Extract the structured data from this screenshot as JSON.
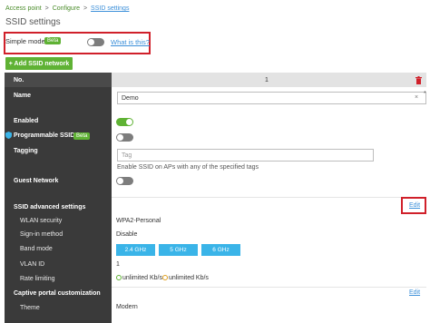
{
  "breadcrumb": {
    "item1": "Access point",
    "item2": "Configure",
    "current": "SSID settings",
    "sep": ">"
  },
  "title": "SSID settings",
  "simple_mode": {
    "label": "Simple mode",
    "badge": "Beta",
    "link": "What is this?"
  },
  "add_button": "+ Add SSID network",
  "header": {
    "no_label": "No.",
    "number": "1"
  },
  "rows": {
    "name": {
      "label": "Name",
      "value": "Demo",
      "clear": "×",
      "required": "*"
    },
    "enabled": {
      "label": "Enabled"
    },
    "programmable": {
      "label": "Programmable SSID",
      "badge": "Beta"
    },
    "tagging": {
      "label": "Tagging",
      "placeholder": "Tag",
      "help": "Enable SSID on APs with any of the specified tags"
    },
    "guest": {
      "label": "Guest Network"
    },
    "advanced": {
      "label": "SSID advanced settings",
      "edit": "Edit"
    },
    "wlan_security": {
      "label": "WLAN security",
      "value": "WPA2-Personal"
    },
    "sign_in": {
      "label": "Sign-in method",
      "value": "Disable"
    },
    "band_mode": {
      "label": "Band mode",
      "bands": [
        "2.4 GHz",
        "5 GHz",
        "6 GHz"
      ]
    },
    "vlan": {
      "label": "VLAN ID",
      "value": "1"
    },
    "rate": {
      "label": "Rate limiting",
      "down": "unlimited Kb/s",
      "up": "unlimited Kb/s"
    },
    "captive": {
      "label": "Captive portal customization",
      "edit": "Edit"
    },
    "theme": {
      "label": "Theme",
      "value": "Modern"
    }
  },
  "colors": {
    "accent_green": "#5fb234",
    "link_blue": "#3b8fd9",
    "highlight_red": "#d0202a",
    "band_blue": "#3ab4e8"
  },
  "icons": {
    "delete": "trash-icon",
    "programmable": "shield-icon"
  }
}
